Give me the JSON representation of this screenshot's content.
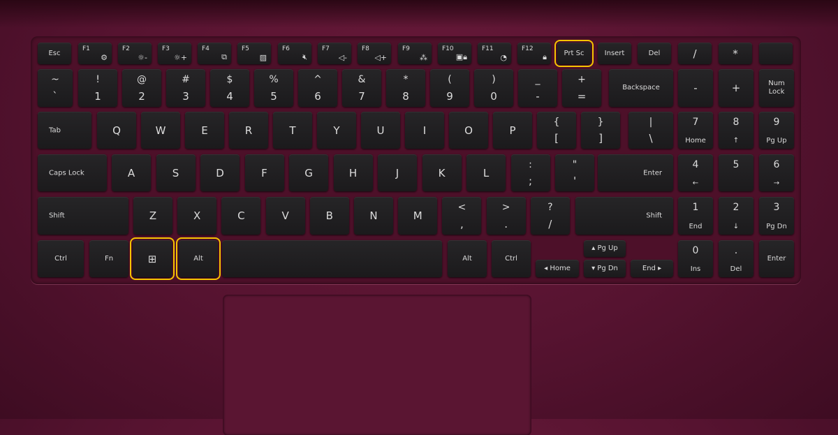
{
  "colors": {
    "body": "#561330",
    "key": "#1e1e20",
    "highlight": "#f5c400",
    "legend": "#dcdcdc"
  },
  "keys": [
    {
      "fn": "",
      "main": "Esc"
    },
    {
      "fn": "F1",
      "icon": "⚙",
      "icon_name": "settings-icon"
    },
    {
      "fn": "F2",
      "icon": "☼-",
      "icon_name": "brightness-down-icon"
    },
    {
      "fn": "F3",
      "icon": "☼+",
      "icon_name": "brightness-up-icon"
    },
    {
      "fn": "F4",
      "icon": "⧉",
      "icon_name": "display-switch-icon"
    },
    {
      "fn": "F5",
      "icon": "▨",
      "icon_name": "touchpad-off-icon"
    },
    {
      "fn": "F6",
      "icon": "🔇︎",
      "icon_name": "mute-icon"
    },
    {
      "fn": "F7",
      "icon": "◁-",
      "icon_name": "volume-down-icon"
    },
    {
      "fn": "F8",
      "icon": "◁+",
      "icon_name": "volume-up-icon"
    },
    {
      "fn": "F9",
      "icon": "⁂",
      "icon_name": "keyboard-backlight-icon"
    },
    {
      "fn": "F10",
      "icon": "▣🔒︎",
      "icon_name": "privacy-lock-icon"
    },
    {
      "fn": "F11",
      "icon": "◔",
      "icon_name": "performance-gauge-icon"
    },
    {
      "fn": "F12",
      "icon": "🔒︎",
      "icon_name": "fn-lock-icon"
    },
    {
      "main": "Prt Sc",
      "highlighted": true
    },
    {
      "main": "Insert"
    },
    {
      "main": "Del"
    },
    {
      "main": "/"
    },
    {
      "main": "*"
    },
    {
      "main": ""
    },
    {
      "top": "~",
      "bottom": "`"
    },
    {
      "top": "!",
      "bottom": "1"
    },
    {
      "top": "@",
      "bottom": "2"
    },
    {
      "top": "#",
      "bottom": "3"
    },
    {
      "top": "$",
      "bottom": "4"
    },
    {
      "top": "%",
      "bottom": "5"
    },
    {
      "top": "^",
      "bottom": "6"
    },
    {
      "top": "&",
      "bottom": "7"
    },
    {
      "top": "*",
      "bottom": "8"
    },
    {
      "top": "(",
      "bottom": "9"
    },
    {
      "top": ")",
      "bottom": "0"
    },
    {
      "top": "_",
      "bottom": "-"
    },
    {
      "top": "+",
      "bottom": "="
    },
    {
      "main": "Backspace"
    },
    {
      "main": "-"
    },
    {
      "main": "+"
    },
    {
      "main": "Num\nLock"
    },
    {
      "main": "Tab"
    },
    {
      "main": "Q"
    },
    {
      "main": "W"
    },
    {
      "main": "E"
    },
    {
      "main": "R"
    },
    {
      "main": "T"
    },
    {
      "main": "Y"
    },
    {
      "main": "U"
    },
    {
      "main": "I"
    },
    {
      "main": "O"
    },
    {
      "main": "P"
    },
    {
      "top": "{",
      "bottom": "["
    },
    {
      "top": "}",
      "bottom": "]"
    },
    {
      "top": "|",
      "bottom": "\\"
    },
    {
      "top": "7",
      "bottom": "Home"
    },
    {
      "top": "8",
      "bottom": "↑"
    },
    {
      "top": "9",
      "bottom": "Pg Up"
    },
    {
      "main": "Caps Lock"
    },
    {
      "main": "A"
    },
    {
      "main": "S"
    },
    {
      "main": "D"
    },
    {
      "main": "F"
    },
    {
      "main": "G"
    },
    {
      "main": "H"
    },
    {
      "main": "J"
    },
    {
      "main": "K"
    },
    {
      "main": "L"
    },
    {
      "top": ":",
      "bottom": ";"
    },
    {
      "top": "\"",
      "bottom": "'"
    },
    {
      "main": "Enter"
    },
    {
      "top": "4",
      "bottom": "←"
    },
    {
      "top": "5",
      "bottom": ""
    },
    {
      "top": "6",
      "bottom": "→"
    },
    {
      "main": "Shift"
    },
    {
      "main": "Z"
    },
    {
      "main": "X"
    },
    {
      "main": "C"
    },
    {
      "main": "V"
    },
    {
      "main": "B"
    },
    {
      "main": "N"
    },
    {
      "main": "M"
    },
    {
      "top": "<",
      "bottom": ","
    },
    {
      "top": ">",
      "bottom": "."
    },
    {
      "top": "?",
      "bottom": "/"
    },
    {
      "main": "Shift"
    },
    {
      "top": "1",
      "bottom": "End"
    },
    {
      "top": "2",
      "bottom": "↓"
    },
    {
      "top": "3",
      "bottom": "Pg Dn"
    },
    {
      "main": "Ctrl"
    },
    {
      "main": "Fn"
    },
    {
      "main": "⊞",
      "icon_name": "windows-icon",
      "highlighted": true
    },
    {
      "main": "Alt",
      "highlighted": true
    },
    {
      "main": ""
    },
    {
      "main": "Alt"
    },
    {
      "main": "Ctrl"
    },
    {
      "main": "◂ Home"
    },
    {
      "main": "▴ Pg Up"
    },
    {
      "main": "▾ Pg Dn"
    },
    {
      "main": "End ▸"
    },
    {
      "top": "0",
      "bottom": "Ins"
    },
    {
      "top": ".",
      "bottom": "Del"
    },
    {
      "main": "Enter"
    }
  ]
}
